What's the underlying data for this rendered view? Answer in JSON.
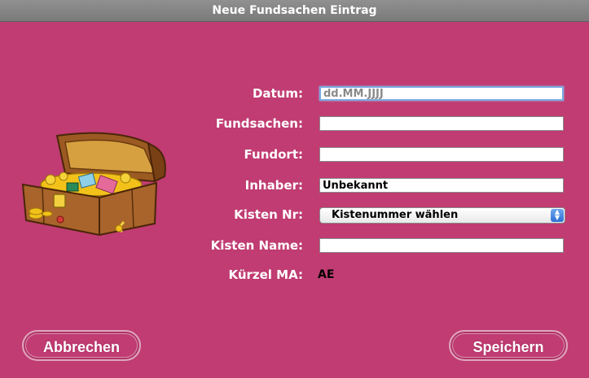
{
  "window": {
    "title": "Neue Fundsachen Eintrag"
  },
  "form": {
    "datum": {
      "label": "Datum:",
      "value": "",
      "placeholder": "dd.MM.JJJJ"
    },
    "fundsachen": {
      "label": "Fundsachen:",
      "value": ""
    },
    "fundort": {
      "label": "Fundort:",
      "value": ""
    },
    "inhaber": {
      "label": "Inhaber:",
      "value": "Unbekannt"
    },
    "kisten_nr": {
      "label": "Kisten Nr:",
      "selected": "Kistenummer wählen"
    },
    "kisten_name": {
      "label": "Kisten Name:",
      "value": ""
    },
    "kuerzel": {
      "label": "Kürzel MA:",
      "value": "AE"
    }
  },
  "buttons": {
    "cancel": "Abbrechen",
    "save": "Speichern"
  },
  "image": {
    "icon": "treasure-chest-icon"
  }
}
